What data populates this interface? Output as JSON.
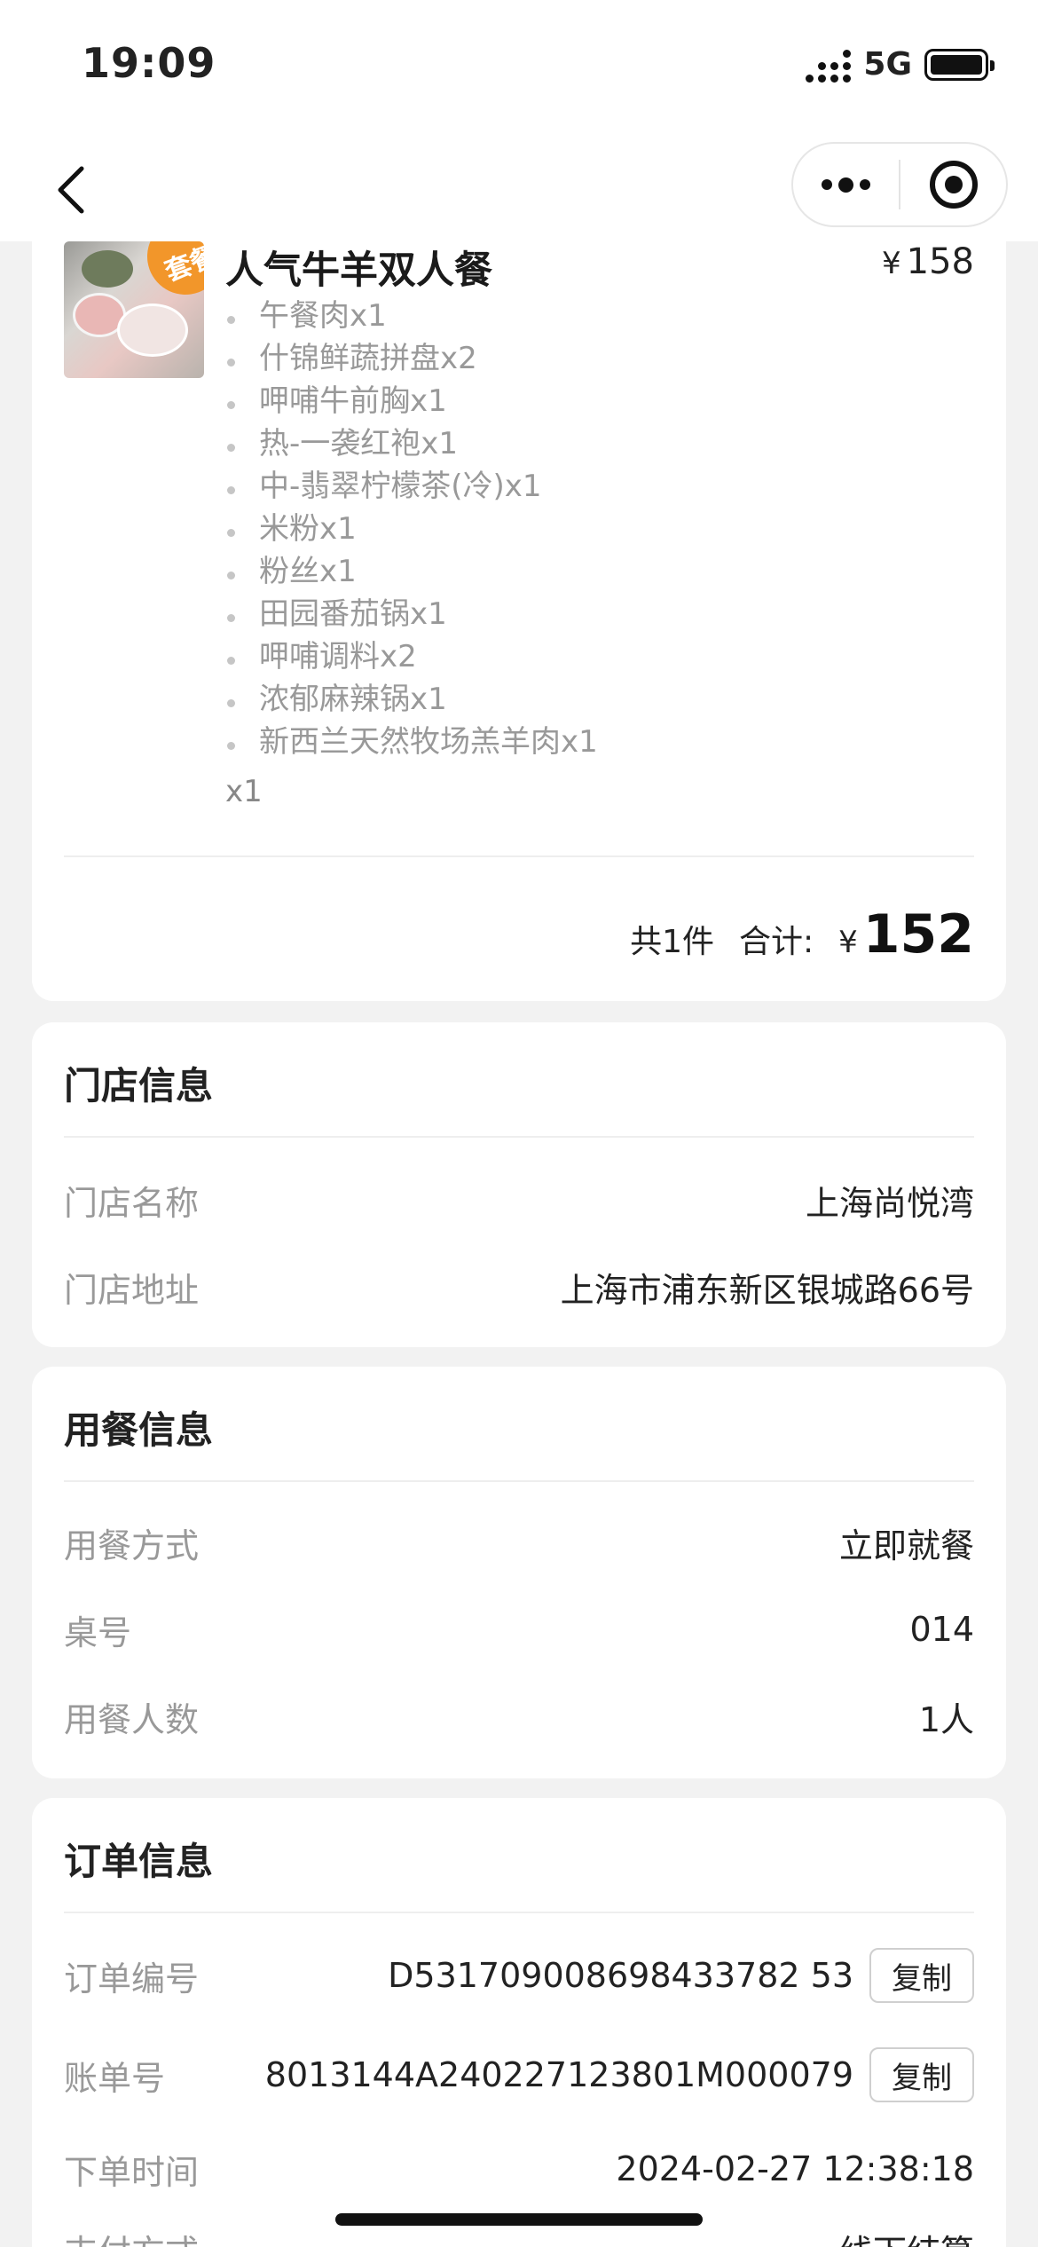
{
  "status_bar": {
    "time": "19:09",
    "network": "5G"
  },
  "product": {
    "name": "人气牛羊双人餐",
    "badge": "套餐",
    "price_symbol": "¥",
    "price": "158",
    "items": [
      "午餐肉x1",
      "什锦鲜蔬拼盘x2",
      "呷哺牛前胸x1",
      "热-一袭红袍x1",
      "中-翡翠柠檬茶(冷)x1",
      "米粉x1",
      "粉丝x1",
      "田园番茄锅x1",
      "呷哺调料x2",
      "浓郁麻辣锅x1",
      "新西兰天然牧场羔羊肉x1"
    ],
    "quantity": "x1"
  },
  "summary": {
    "count": "共1件",
    "total_label": "合计:",
    "currency": "¥",
    "total": "152"
  },
  "store": {
    "title": "门店信息",
    "rows": [
      {
        "label": "门店名称",
        "value": "上海尚悦湾"
      },
      {
        "label": "门店地址",
        "value": "上海市浦东新区银城路66号"
      }
    ]
  },
  "dining": {
    "title": "用餐信息",
    "rows": [
      {
        "label": "用餐方式",
        "value": "立即就餐"
      },
      {
        "label": "桌号",
        "value": "014"
      },
      {
        "label": "用餐人数",
        "value": "1人"
      }
    ]
  },
  "order": {
    "title": "订单信息",
    "copy_label": "复制",
    "rows": [
      {
        "label": "订单编号",
        "value": "D531709008698433782 53"
      },
      {
        "label": "账单号",
        "value": "8013144A240227123801M000079"
      },
      {
        "label": "下单时间",
        "value": "2024-02-27 12:38:18"
      },
      {
        "label": "支付方式",
        "value": "线下结算"
      }
    ]
  }
}
